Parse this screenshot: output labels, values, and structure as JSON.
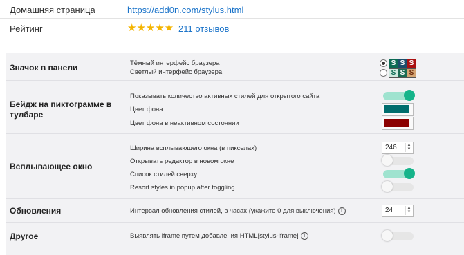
{
  "header": {
    "homepage_label": "Домашняя страница",
    "homepage_url": "https://add0n.com/stylus.html",
    "rating_label": "Рейтинг",
    "stars": "★★★★★",
    "rating_value": 5,
    "reviews": "211 отзывов"
  },
  "sections": {
    "icon": {
      "title": "Значок в панели",
      "dark": "Тёмный интерфейс браузера",
      "light": "Светлый интерфейс браузера",
      "selected": "dark",
      "s_letter": "S"
    },
    "badge": {
      "title": "Бейдж на пиктограмме в тулбаре",
      "show_count": "Показывать количество активных стилей для открытого сайта",
      "show_count_on": true,
      "bg_color_label": "Цвет фона",
      "bg_color": "#006d6d",
      "bg_inactive_label": "Цвет фона в неактивном состоянии",
      "bg_inactive_color": "#8b0000"
    },
    "popup": {
      "title": "Всплывающее окно",
      "width_label": "Ширина всплывающего окна (в пикселах)",
      "width_value": "246",
      "open_editor": "Открывать редактор в новом окне",
      "open_editor_on": false,
      "list_top": "Список стилей сверху",
      "list_top_on": true,
      "resort": "Resort styles in popup after toggling",
      "resort_on": false
    },
    "updates": {
      "title": "Обновления",
      "interval_label": "Интервал обновления стилей, в часах (укажите 0 для выключения)",
      "interval_value": "24"
    },
    "other": {
      "title": "Другое",
      "iframe_label": "Выявлять iframe путем добавления HTML[stylus-iframe]",
      "iframe_on": false
    }
  },
  "colors": {
    "accent": "#16b48a",
    "link": "#1a73c9",
    "star": "#f4b400"
  },
  "icons": {
    "info": "i",
    "spin_up": "▲",
    "spin_down": "▼"
  }
}
